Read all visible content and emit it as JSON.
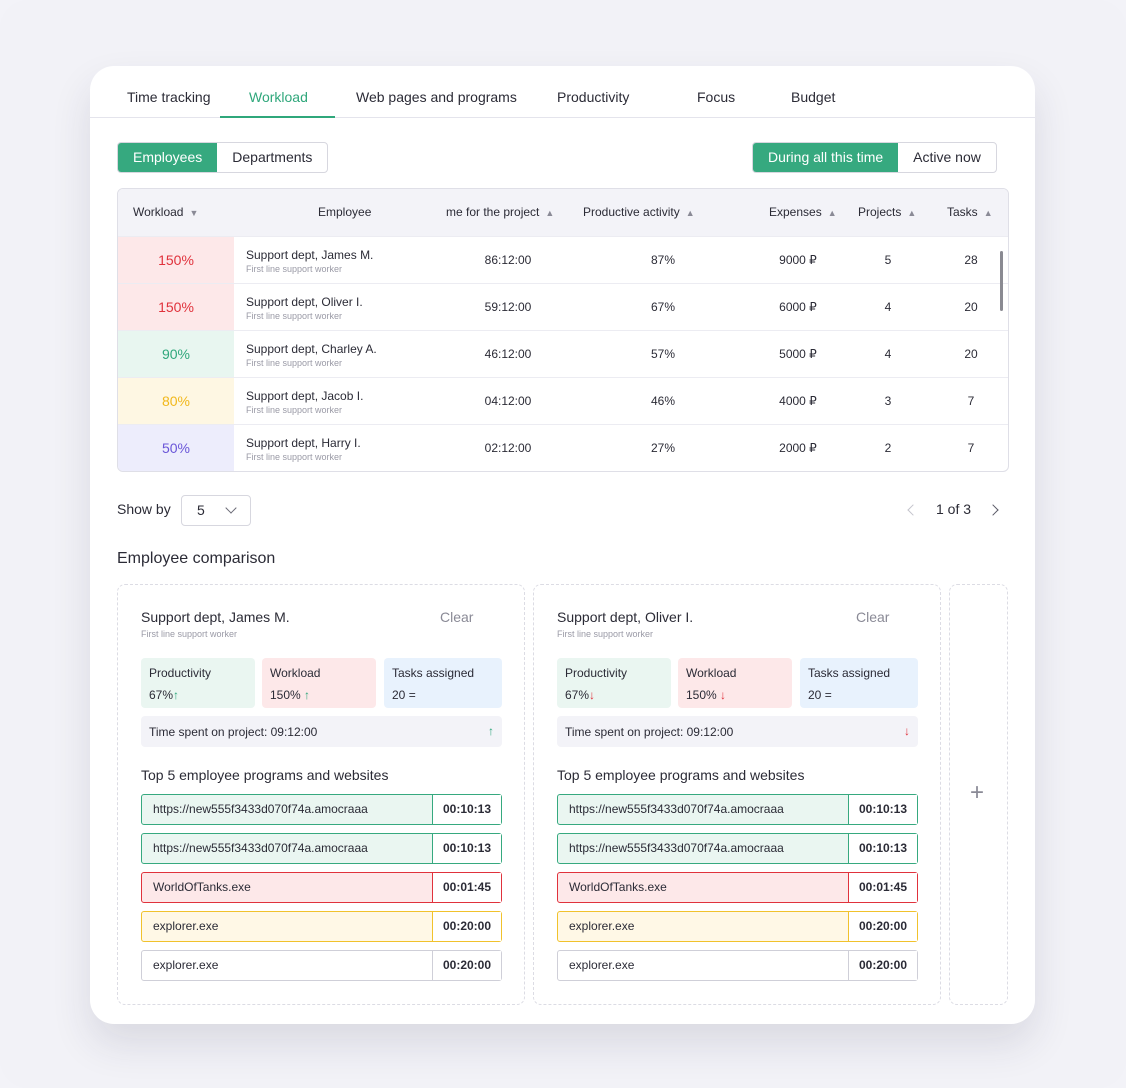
{
  "tabs": [
    {
      "label": "Time tracking"
    },
    {
      "label": "Workload"
    },
    {
      "label": "Web pages and programs"
    },
    {
      "label": "Productivity"
    },
    {
      "label": "Focus"
    },
    {
      "label": "Budget"
    }
  ],
  "active_tab": "Workload",
  "view_toggle": {
    "employees": "Employees",
    "departments": "Departments",
    "selected": "Employees"
  },
  "period_toggle": {
    "all_time": "During all this time",
    "active_now": "Active now",
    "selected": "During all this time"
  },
  "table": {
    "headers": {
      "workload": "Workload",
      "employee": "Employee",
      "time": "me for the project",
      "productive": "Productive activity",
      "expenses": "Expenses",
      "projects": "Projects",
      "tasks": "Tasks"
    },
    "rows": [
      {
        "workload": "150%",
        "name": "Support dept, James M.",
        "role": "First line support worker",
        "time": "86:12:00",
        "productive": "87%",
        "expenses": "9000 ₽",
        "projects": "5",
        "tasks": "28"
      },
      {
        "workload": "150%",
        "name": "Support dept, Oliver I.",
        "role": "First line support worker",
        "time": "59:12:00",
        "productive": "67%",
        "expenses": "6000 ₽",
        "projects": "4",
        "tasks": "20"
      },
      {
        "workload": "90%",
        "name": "Support dept, Charley A.",
        "role": "First line support worker",
        "time": "46:12:00",
        "productive": "57%",
        "expenses": "5000 ₽",
        "projects": "4",
        "tasks": "20"
      },
      {
        "workload": "80%",
        "name": "Support dept, Jacob I.",
        "role": "First line support worker",
        "time": "04:12:00",
        "productive": "46%",
        "expenses": "4000 ₽",
        "projects": "3",
        "tasks": "7"
      },
      {
        "workload": "50%",
        "name": "Support dept, Harry I.",
        "role": "First line support worker",
        "time": "02:12:00",
        "productive": "27%",
        "expenses": "2000 ₽",
        "projects": "2",
        "tasks": "7"
      }
    ],
    "workload_colors": [
      {
        "bg": "#fde8e9",
        "fg": "#e0323c"
      },
      {
        "bg": "#fde8e9",
        "fg": "#e0323c"
      },
      {
        "bg": "#e8f6f0",
        "fg": "#2fa77b"
      },
      {
        "bg": "#fef7e3",
        "fg": "#f1b81c"
      },
      {
        "bg": "#ededfc",
        "fg": "#6a56d8"
      }
    ]
  },
  "pager": {
    "show_by_label": "Show by",
    "show_by_value": "5",
    "page_info": "1 of 3"
  },
  "comparison": {
    "title": "Employee comparison",
    "panels": [
      {
        "name": "Support dept, James M.",
        "role": "First line support worker",
        "clear": "Clear",
        "productivity_label": "Productivity",
        "productivity_value": "67%",
        "productivity_trend": "↑",
        "workload_label": "Workload",
        "workload_value": "150%",
        "workload_trend": "↑",
        "tasks_label": "Tasks assigned",
        "tasks_value": "20",
        "tasks_trend": "=",
        "time_spent": "Time spent on project: 09:12:00",
        "time_trend": "↑",
        "top5_title": "Top 5 employee programs and websites",
        "programs": [
          {
            "name": "https://new555f3433d070f74a.amocraaa",
            "time": "00:10:13"
          },
          {
            "name": "https://new555f3433d070f74a.amocraaa",
            "time": "00:10:13"
          },
          {
            "name": "WorldOfTanks.exe",
            "time": "00:01:45"
          },
          {
            "name": "explorer.exe",
            "time": "00:20:00"
          },
          {
            "name": "explorer.exe",
            "time": "00:20:00"
          }
        ]
      },
      {
        "name": "Support dept, Oliver I.",
        "role": "First line support worker",
        "clear": "Clear",
        "productivity_label": "Productivity",
        "productivity_value": "67%",
        "productivity_trend": "↓",
        "workload_label": "Workload",
        "workload_value": "150%",
        "workload_trend": "↓",
        "tasks_label": "Tasks assigned",
        "tasks_value": "20",
        "tasks_trend": "=",
        "time_spent": "Time spent on project: 09:12:00",
        "time_trend": "↓",
        "top5_title": "Top 5 employee programs and websites",
        "programs": [
          {
            "name": "https://new555f3433d070f74a.amocraaa",
            "time": "00:10:13"
          },
          {
            "name": "https://new555f3433d070f74a.amocraaa",
            "time": "00:10:13"
          },
          {
            "name": "WorldOfTanks.exe",
            "time": "00:01:45"
          },
          {
            "name": "explorer.exe",
            "time": "00:20:00"
          },
          {
            "name": "explorer.exe",
            "time": "00:20:00"
          }
        ]
      }
    ],
    "add_icon": "plus-icon"
  },
  "colors": {
    "accent": "#36a97f",
    "good_bg": "#eaf6f1",
    "good_border": "#36a97f",
    "bad_bg": "#fde8e9",
    "bad_border": "#e0323c",
    "warn_bg": "#fff8e6",
    "warn_border": "#f1c22c",
    "info_bg": "#e8f2fd",
    "neutral_border": "#cfcfd8"
  }
}
